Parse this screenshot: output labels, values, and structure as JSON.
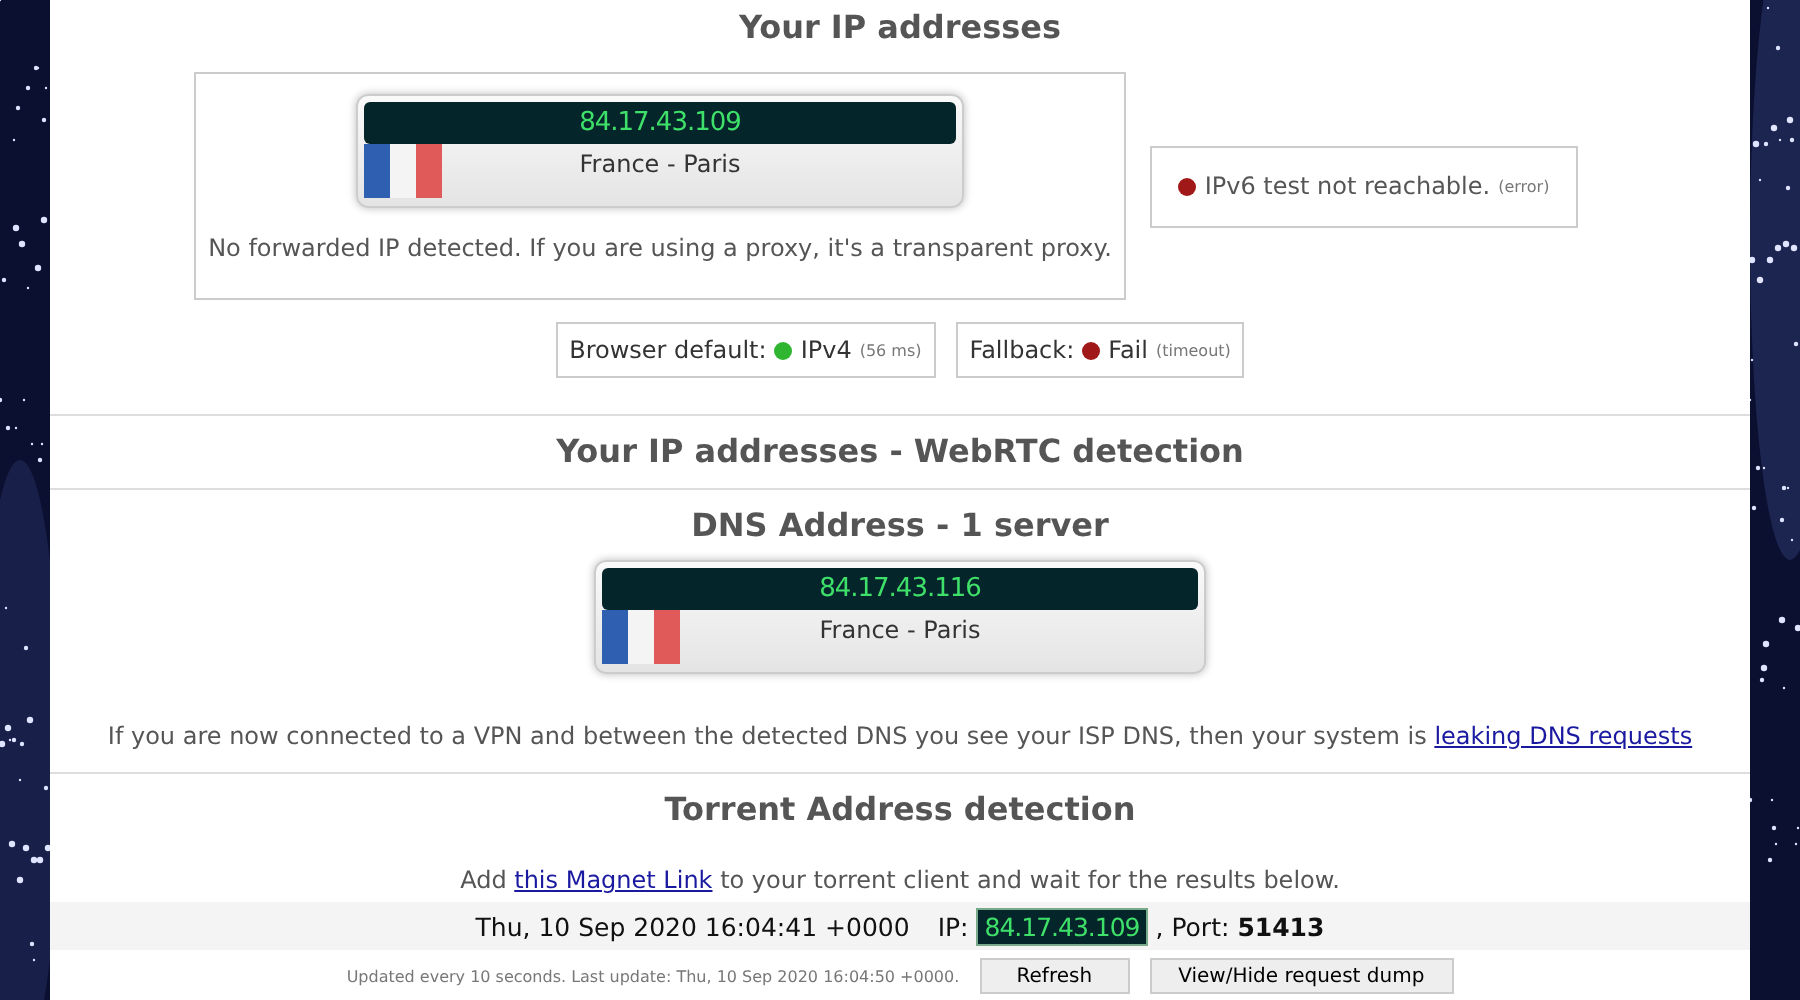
{
  "ip_section": {
    "title": "Your IP addresses",
    "ip_card": {
      "ip": "84.17.43.109",
      "location": "France - Paris"
    },
    "forward_note": "No forwarded IP detected. If you are using a proxy, it's a transparent proxy.",
    "ipv6": {
      "color": "#a01818",
      "text": "IPv6 test not reachable.",
      "note": "(error)"
    },
    "checks": [
      {
        "label": "Browser default:",
        "color": "#2fb52f",
        "value": "IPv4",
        "note": "(56 ms)"
      },
      {
        "label": "Fallback:",
        "color": "#a01818",
        "value": "Fail",
        "note": "(timeout)"
      }
    ]
  },
  "webrtc": {
    "title": "Your IP addresses - WebRTC detection"
  },
  "dns": {
    "title": "DNS Address - 1 server",
    "cards": [
      {
        "ip": "84.17.43.116",
        "location": "France - Paris"
      }
    ],
    "note_before": "If you are now connected to a VPN and between the detected DNS you see your ISP DNS, then your system is",
    "note_link": "leaking DNS requests"
  },
  "torrent": {
    "title": "Torrent Address detection",
    "add_before": "Add",
    "add_link": "this Magnet Link",
    "add_after": "to your torrent client and wait for the results below.",
    "time": "Thu, 10 Sep 2020 16:04:41 +0000",
    "ip_label": "IP:",
    "ip": "84.17.43.109",
    "port_label": ", Port:",
    "port": "51413",
    "updated": "Updated every 10 seconds. Last update: Thu, 10 Sep 2020 16:04:50 +0000.",
    "buttons": [
      "Refresh",
      "View/Hide request dump"
    ]
  }
}
